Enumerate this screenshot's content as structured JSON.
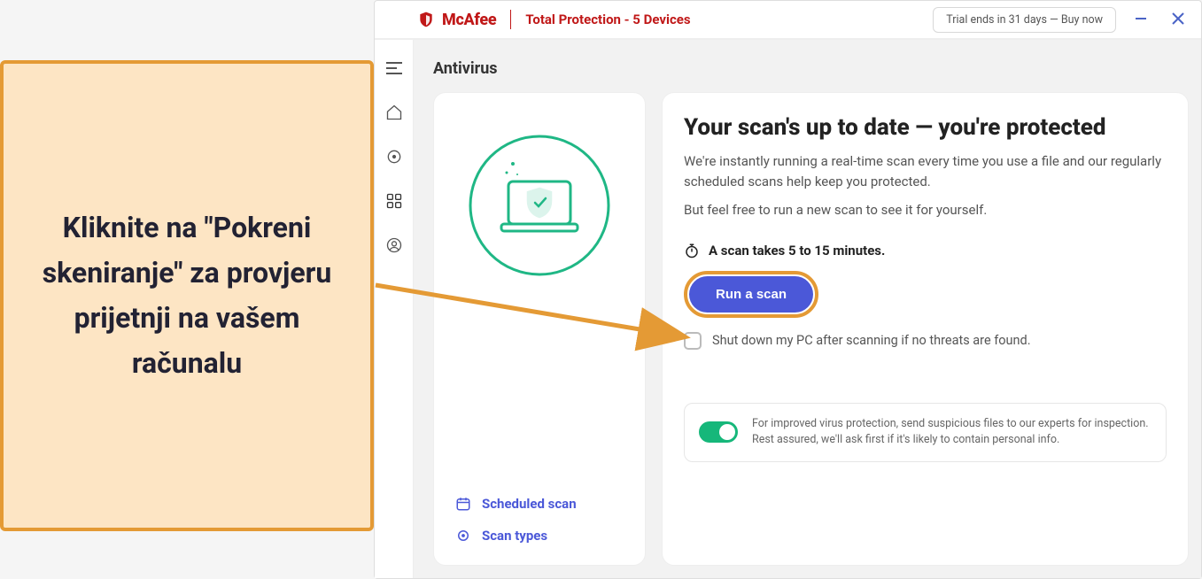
{
  "callout": {
    "text": "Kliknite na \"Pokreni skeniranje\" za provjeru prijetnji na vašem računalu"
  },
  "brand": {
    "name": "McAfee",
    "subtitle": "Total Protection - 5 Devices"
  },
  "titlebar": {
    "trial": "Trial ends in 31 days — Buy now"
  },
  "page": {
    "title": "Antivirus"
  },
  "leftcard": {
    "link_scheduled": "Scheduled scan",
    "link_types": "Scan types"
  },
  "scan": {
    "heading": "Your scan's up to date — you're protected",
    "body1": "We're instantly running a real-time scan every time you use a file and our regularly scheduled scans help keep you protected.",
    "body2": "But feel free to run a new scan to see it for yourself.",
    "timer": "A scan takes 5 to 15 minutes.",
    "run_label": "Run a scan",
    "checkbox_label": "Shut down my PC after scanning if no threats are found."
  },
  "footer": {
    "text": "For improved virus protection, send suspicious files to our experts for inspection. Rest assured, we'll ask first if it's likely to contain personal info."
  }
}
